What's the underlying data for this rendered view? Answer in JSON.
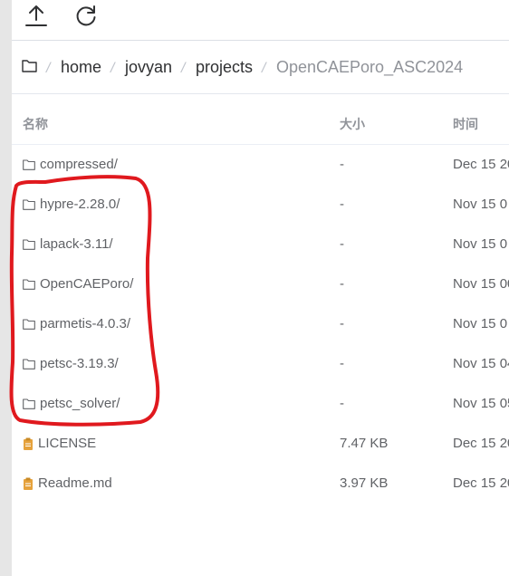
{
  "toolbar": {
    "upload_icon": "upload-icon",
    "refresh_icon": "refresh-icon"
  },
  "breadcrumb": {
    "root_icon": "folder-icon",
    "separator": "/",
    "items": [
      "home",
      "jovyan",
      "projects",
      "OpenCAEPoro_ASC2024"
    ]
  },
  "table": {
    "columns": {
      "name": "名称",
      "size": "大小",
      "time": "时间"
    },
    "rows": [
      {
        "name": "compressed/",
        "size": "-",
        "time": "Dec 15 20",
        "type": "folder"
      },
      {
        "name": "hypre-2.28.0/",
        "size": "-",
        "time": "Nov 15 0",
        "type": "folder"
      },
      {
        "name": "lapack-3.11/",
        "size": "-",
        "time": "Nov 15 0",
        "type": "folder"
      },
      {
        "name": "OpenCAEPoro/",
        "size": "-",
        "time": "Nov 15 00",
        "type": "folder"
      },
      {
        "name": "parmetis-4.0.3/",
        "size": "-",
        "time": "Nov 15 0",
        "type": "folder"
      },
      {
        "name": "petsc-3.19.3/",
        "size": "-",
        "time": "Nov 15 04",
        "type": "folder"
      },
      {
        "name": "petsc_solver/",
        "size": "-",
        "time": "Nov 15 05",
        "type": "folder"
      },
      {
        "name": "LICENSE",
        "size": "7.47 KB",
        "time": "Dec 15 20",
        "type": "file"
      },
      {
        "name": "Readme.md",
        "size": "3.97 KB",
        "time": "Dec 15 20",
        "type": "file"
      }
    ]
  },
  "colors": {
    "annotation": "#e0191e",
    "file_icon": "#e6a23c",
    "current_crumb": "#909399"
  }
}
